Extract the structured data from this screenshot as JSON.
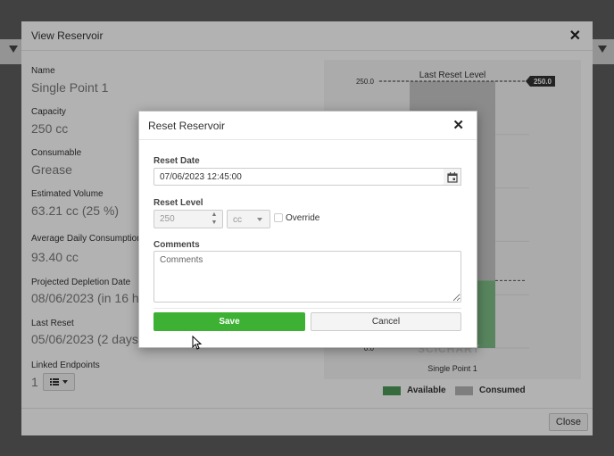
{
  "outer_dialog": {
    "title": "View Reservoir",
    "close_glyph": "✕",
    "fields": [
      {
        "label": "Name",
        "value": "Single Point 1"
      },
      {
        "label": "Capacity",
        "value": "250 cc"
      },
      {
        "label": "Consumable",
        "value": "Grease"
      },
      {
        "label": "Estimated Volume",
        "value": "63.21 cc (25 %)"
      },
      {
        "label": "Average Daily Consumption",
        "value": "93.40 cc"
      },
      {
        "label": "Projected Depletion Date",
        "value": "08/06/2023 (in 16 h"
      },
      {
        "label": "Last Reset",
        "value": "05/06/2023 (2 days"
      },
      {
        "label": "Linked Endpoints",
        "value": "1"
      }
    ],
    "close_button_label": "Close"
  },
  "chart_data": {
    "type": "bar",
    "categories": [
      "Single Point 1"
    ],
    "series": [
      {
        "name": "Available",
        "values": [
          63.21
        ]
      },
      {
        "name": "Consumed",
        "values": [
          186.79
        ]
      }
    ],
    "ylim": [
      0,
      250
    ],
    "y_ticks": [
      "250.0",
      "0.0"
    ],
    "reference_line": {
      "label": "Last Reset Level",
      "value": 250.0,
      "badge": "250.0"
    },
    "watermark": "SCICHART",
    "colors": {
      "available": "#7fbf87",
      "consumed": "#c8c8c8",
      "reference": "#333333"
    }
  },
  "reset_modal": {
    "title": "Reset Reservoir",
    "close_glyph": "✕",
    "reset_date_label": "Reset Date",
    "reset_date_value": "07/06/2023 12:45:00",
    "reset_level_label": "Reset Level",
    "reset_level_value": "250",
    "unit_value": "cc",
    "override_label": "Override",
    "comments_label": "Comments",
    "comments_placeholder": "Comments",
    "save_label": "Save",
    "cancel_label": "Cancel"
  },
  "colors": {
    "save_button": "#3cb133",
    "overlay": "rgba(0,0,0,0.3)"
  }
}
